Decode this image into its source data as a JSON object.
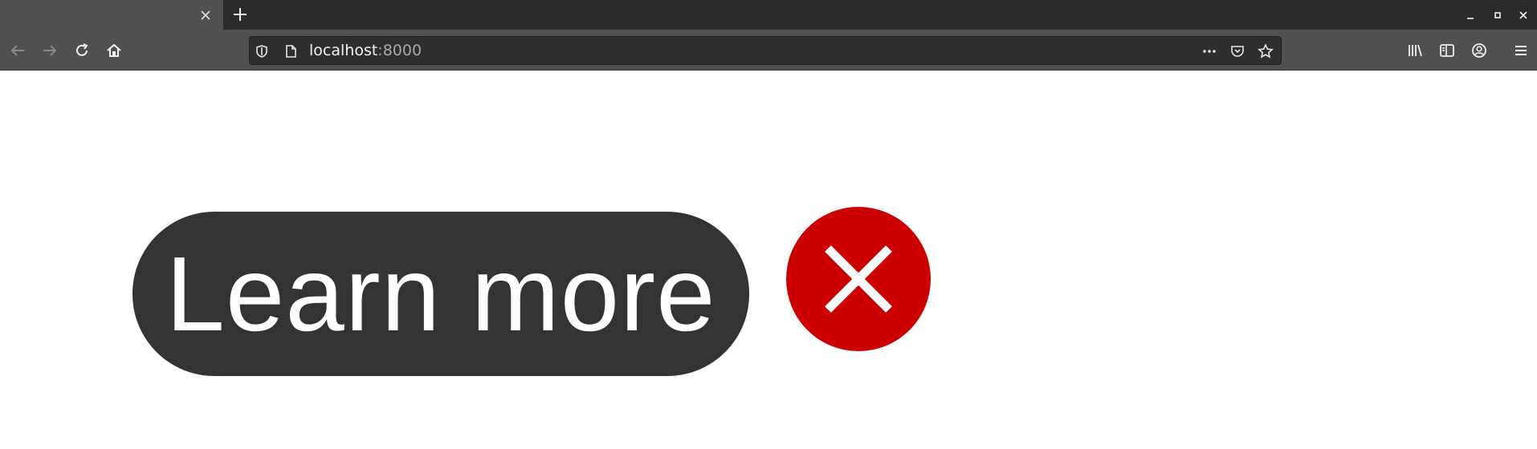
{
  "browser": {
    "tab": {
      "close_glyph": "✕"
    },
    "new_tab_glyph": "+",
    "window_controls": {
      "minimize": "–",
      "maximize": "▫",
      "close": "✕"
    },
    "url": {
      "host": "localhost",
      "port": ":8000",
      "more_glyph": "•••"
    }
  },
  "page": {
    "button_label": "Learn more",
    "colors": {
      "button_bg": "#333333",
      "close_bg": "#cc0000",
      "text": "#ffffff"
    }
  },
  "icons": [
    "back-icon",
    "forward-icon",
    "reload-icon",
    "home-icon",
    "shield-icon",
    "page-icon",
    "more-icon",
    "pocket-icon",
    "star-icon",
    "library-icon",
    "sidebar-icon",
    "account-icon",
    "menu-icon",
    "close-icon"
  ]
}
